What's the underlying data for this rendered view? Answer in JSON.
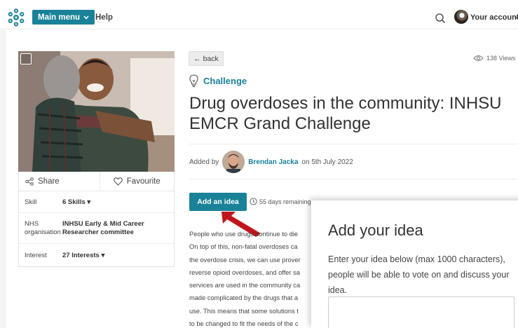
{
  "header": {
    "main_menu_label": "Main menu",
    "help_label": "Help",
    "account_label": "Your account"
  },
  "back_label": "← back",
  "views": "138 Views",
  "type_label": "Challenge",
  "title": "Drug overdoses in the community: INHSU EMCR Grand Challenge",
  "added_by": {
    "prefix": "Added by",
    "author": "Brendan Jacka",
    "date": "on 5th July 2022"
  },
  "add_idea_label": "Add an idea",
  "remaining": "55 days remaining",
  "share_label": "Share",
  "favourite_label": "Favourite",
  "details": [
    {
      "key": "Skill",
      "value": "6 Skills"
    },
    {
      "key": "NHS organisation",
      "value": "INHSU Early & Mid Career Researcher committee"
    },
    {
      "key": "Interest",
      "value": "27 Interests"
    }
  ],
  "body_lines": [
    "People who use drugs continue to die",
    "On top of this, non-fatal overdoses ca",
    "the overdose crisis, we can use prover",
    "reverse opioid overdoses, and offer sa",
    "services are used in the community ca",
    "made complicated by the drugs that a",
    "use. This means that some solutions t",
    "to be changed to fit the needs of the c"
  ],
  "panel": {
    "title": "Add your idea",
    "description": "Enter your idea below (max 1000 characters), people will be able to vote on and discuss your idea."
  },
  "colors": {
    "accent": "#1a8298",
    "arrow": "#c0161b"
  }
}
